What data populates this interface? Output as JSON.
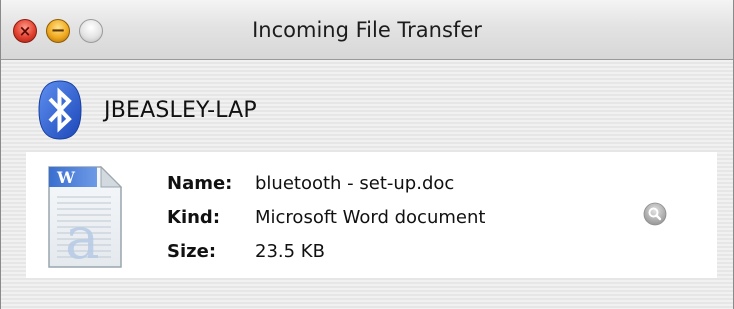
{
  "window": {
    "title": "Incoming File Transfer"
  },
  "colors": {
    "close": "#e2412f",
    "minimize": "#f0a91f",
    "zoom": "#e4e4e4",
    "bluetooth": "#2a5fcf"
  },
  "device": {
    "icon": "bluetooth-icon",
    "name": "JBEASLEY-LAP"
  },
  "file": {
    "icon": "word-document-icon",
    "rows": [
      {
        "label": "Name:",
        "value": "bluetooth - set-up.doc"
      },
      {
        "label": "Kind:",
        "value": "Microsoft Word document"
      },
      {
        "label": "Size:",
        "value": "23.5 KB"
      }
    ],
    "reveal_icon": "magnifier-icon"
  }
}
